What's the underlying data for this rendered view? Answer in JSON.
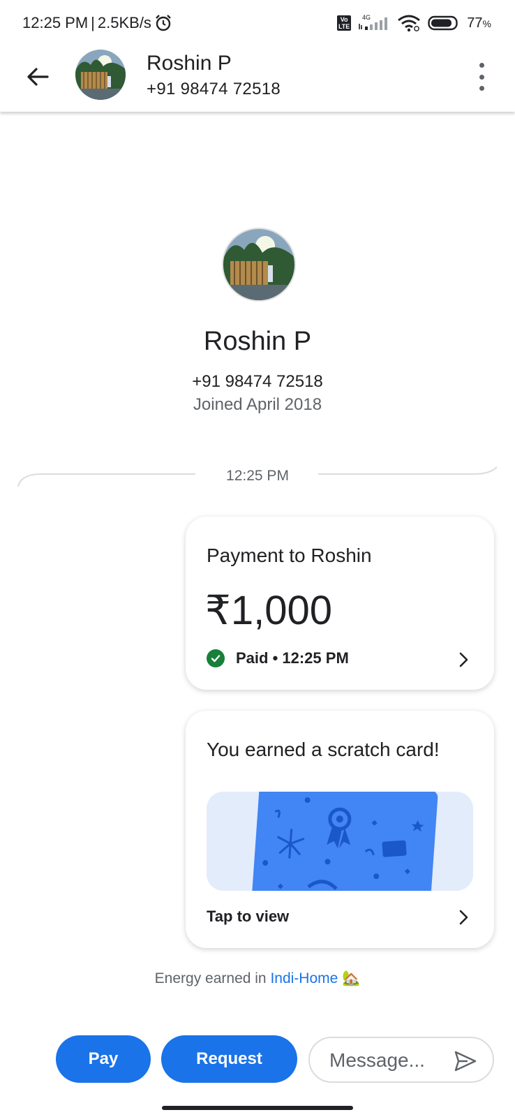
{
  "status_bar": {
    "time": "12:25 PM",
    "separator": "|",
    "speed": "2.5KB/s",
    "network": "4G",
    "volte": "Vo LTE",
    "battery": "77",
    "battery_unit": "%"
  },
  "header": {
    "name": "Roshin P",
    "phone": "+91 98474 72518"
  },
  "profile": {
    "name": "Roshin P",
    "phone": "+91 98474 72518",
    "joined": "Joined April 2018"
  },
  "divider_time": "12:25 PM",
  "payment": {
    "title": "Payment to Roshin",
    "amount": "₹1,000",
    "status": "Paid • 12:25 PM"
  },
  "scratch": {
    "title": "You earned a scratch card!",
    "tap_label": "Tap to view"
  },
  "energy": {
    "prefix": "Energy earned in ",
    "link": "Indi-Home",
    "emoji": "🏡"
  },
  "bottom": {
    "pay_label": "Pay",
    "request_label": "Request",
    "message_placeholder": "Message..."
  },
  "colors": {
    "primary": "#1a73e8",
    "success": "#188038",
    "scratch_blue": "#4285f4",
    "scratch_bg": "#e3ecfb"
  }
}
